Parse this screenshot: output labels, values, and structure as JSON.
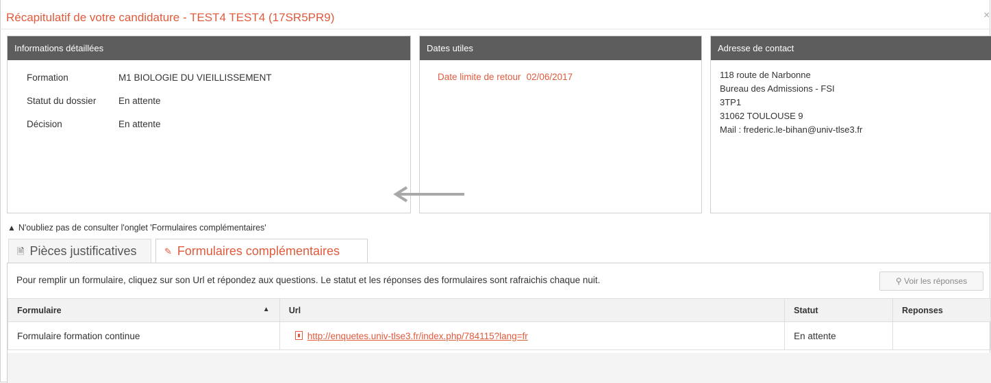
{
  "modal": {
    "title": "Récapitulatif de votre candidature - TEST4 TEST4 (17SR5PR9)",
    "close_symbol": "×"
  },
  "panels": {
    "details": {
      "header": "Informations détaillées",
      "rows": [
        {
          "label": "Formation",
          "value": "M1 BIOLOGIE DU VIEILLISSEMENT"
        },
        {
          "label": "Statut du dossier",
          "value": "En attente"
        },
        {
          "label": "Décision",
          "value": "En attente"
        }
      ]
    },
    "dates": {
      "header": "Dates utiles",
      "deadline_label": "Date limite de retour",
      "deadline_value": "02/06/2017"
    },
    "contact": {
      "header": "Adresse de contact",
      "lines": [
        "118 route de Narbonne",
        "Bureau des Admissions - FSI",
        "3TP1",
        "31062 TOULOUSE 9",
        "Mail : frederic.le-bihan@univ-tlse3.fr"
      ]
    }
  },
  "warning": "N'oubliez pas de consulter l'onglet 'Formulaires complémentaires'",
  "tabs": [
    {
      "label": "Pièces justificatives",
      "icon": "document-icon",
      "active": false
    },
    {
      "label": "Formulaires complémentaires",
      "icon": "edit-icon",
      "active": true
    }
  ],
  "forms": {
    "instructions": "Pour remplir un formulaire, cliquez sur son Url et répondez aux questions. Le statut et les réponses des formulaires sont rafraichis chaque nuit.",
    "view_button": "Voir les réponses",
    "columns": [
      "Formulaire",
      "Url",
      "Statut",
      "Reponses"
    ],
    "rows": [
      {
        "formulaire": "Formulaire formation continue",
        "url": "http://enquetes.univ-tlse3.fr/index.php/784115?lang=fr",
        "statut": "En attente",
        "reponses": ""
      }
    ]
  },
  "colors": {
    "accent": "#e05a3c",
    "panel_header": "#5d5d5d"
  }
}
